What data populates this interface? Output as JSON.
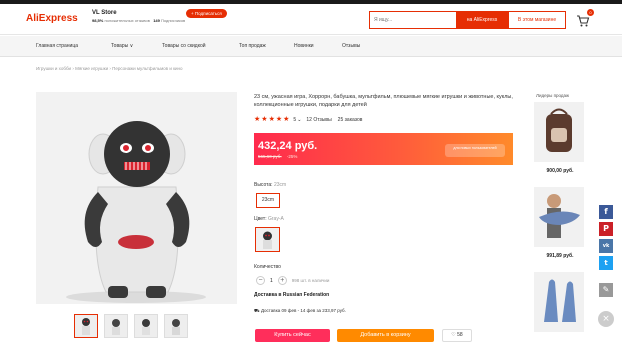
{
  "header": {
    "logo": "AliExpress",
    "store_name": "VL Store",
    "store_rating": "98,5%",
    "store_rating_text": "положительных отзывов",
    "store_followers": "149",
    "store_followers_text": "Подписчиков",
    "subscribe_label": "+ Подписаться",
    "search_placeholder": "Я ищу...",
    "search_aliexpress_label": "на AliExpress",
    "search_store_label": "В этом магазине",
    "cart_count": "0"
  },
  "nav": {
    "items": [
      "Главная страница",
      "Товары ∨",
      "Товары со скидкой",
      "Топ продаж",
      "Новинки",
      "Отзывы"
    ]
  },
  "breadcrumb": [
    "Игрушки и хобби",
    "Мягкие игрушки",
    "Персонажи мультфильмов и кино"
  ],
  "product": {
    "title": "23 см, ужасная игра, Хоррорн, бабушка, мультфильм, плюшевые мягкие игрушки и животные, куклы, коллекционные игрушки, подарки для детей",
    "rating": "5",
    "reviews": "12 Отзывы",
    "orders": "25 заказов",
    "price": "432,24 руб.",
    "old_price": "565,60 руб.",
    "discount": "-25%",
    "promo_text": "для новых пользователей",
    "height_label": "Высота:",
    "height_value": "23cm",
    "height_option": "23cm",
    "color_label": "Цвет:",
    "color_value": "Gray-A",
    "quantity_label": "Количество",
    "quantity_value": "1",
    "quantity_available": "998 шт. в наличии",
    "delivery_title": "Доставка в Russian Federation",
    "delivery_info": "Доставка 09 фев - 14 фев за 233,97 руб.",
    "buy_now_label": "Купить сейчас",
    "add_to_cart_label": "Добавить в корзину",
    "wishlist_count": "58"
  },
  "recommendations": {
    "title": "Лидеры продаж",
    "items": [
      {
        "price": "900,00 руб."
      },
      {
        "price": "991,89 руб."
      }
    ]
  },
  "share": {
    "facebook_color": "#3b5998",
    "pinterest_color": "#cb2027",
    "vk_color": "#4a76a8",
    "twitter_color": "#1da1f2",
    "edit_color": "#999999"
  }
}
